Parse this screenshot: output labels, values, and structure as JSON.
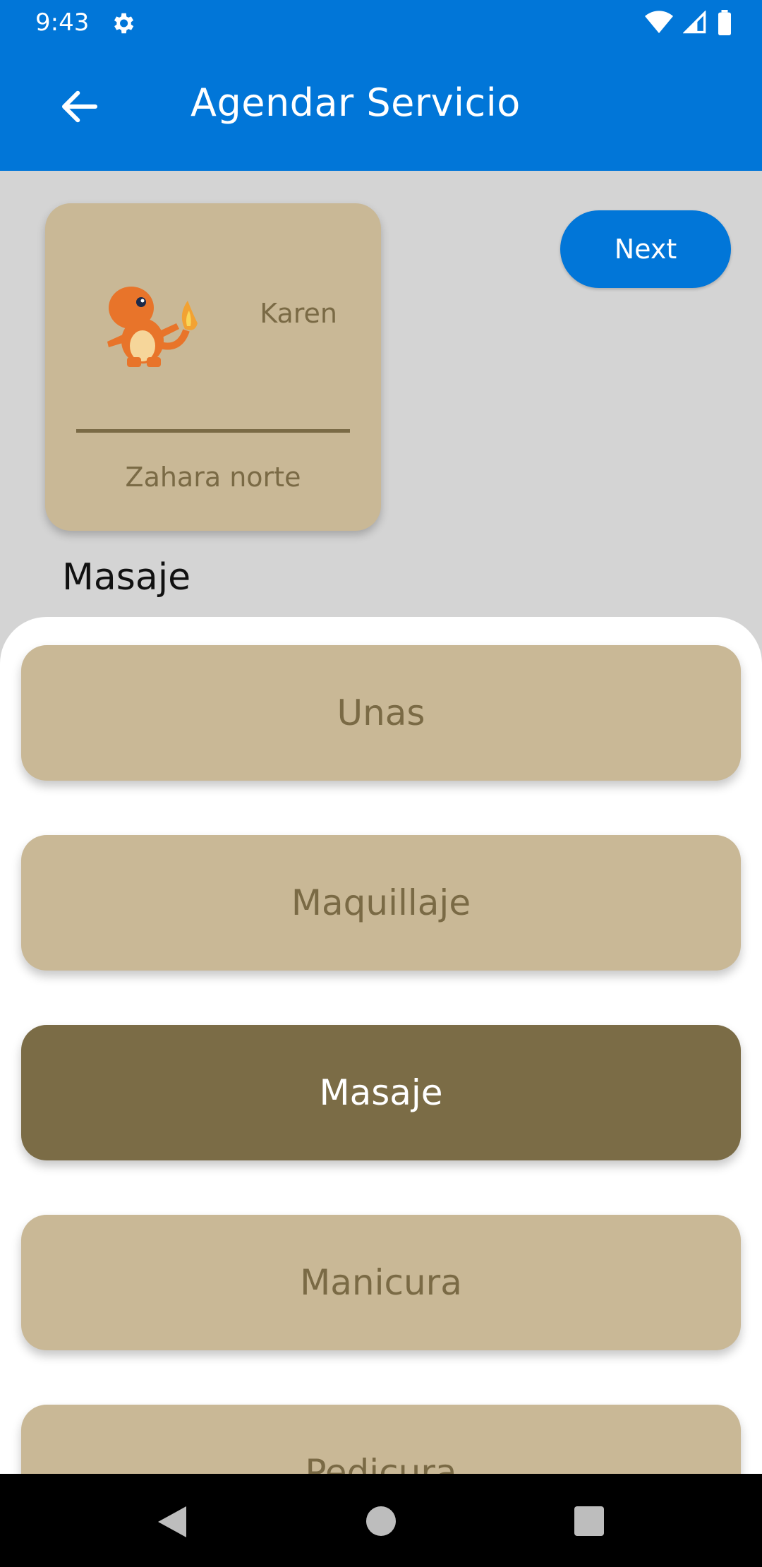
{
  "status_bar": {
    "time": "9:43"
  },
  "app_bar": {
    "title": "Agendar Servicio"
  },
  "provider": {
    "name": "Karen",
    "location": "Zahara norte"
  },
  "next_button": {
    "label": "Next"
  },
  "selected_service": "Masaje",
  "services": [
    {
      "label": "Unas",
      "selected": false
    },
    {
      "label": "Maquillaje",
      "selected": false
    },
    {
      "label": "Masaje",
      "selected": true
    },
    {
      "label": "Manicura",
      "selected": false
    },
    {
      "label": "Pedicura",
      "selected": false
    }
  ],
  "colors": {
    "primary": "#0176d8",
    "card": "#c9b896",
    "card_text": "#7a6a45",
    "selected": "#7b6c46",
    "background": "#d4d4d4"
  },
  "icons": {
    "status": [
      "gear-icon",
      "wifi-icon",
      "signal-icon",
      "battery-icon"
    ],
    "app_bar": "arrow-back-icon",
    "avatar": "charmander-sprite",
    "nav": [
      "nav-back-icon",
      "nav-home-icon",
      "nav-recents-icon"
    ]
  }
}
